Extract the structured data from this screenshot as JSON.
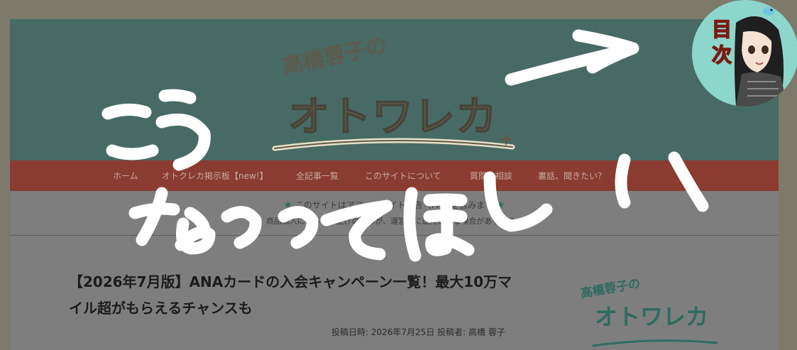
{
  "header": {
    "logo_subtitle": "高橋蓉子の",
    "logo_main": "オトワレカ"
  },
  "nav": {
    "items": [
      {
        "label": "ホーム"
      },
      {
        "label": "オトクレカ掲示板【new!】"
      },
      {
        "label": "全記事一覧"
      },
      {
        "label": "このサイトについて"
      },
      {
        "label": "質問・相談"
      },
      {
        "label": "裏話、聞きたい？"
      }
    ]
  },
  "notice": {
    "line1": "このサイトはアフィリエイト広告（PR）を含みます",
    "line2": "商品購入による売り上げの一部が、運営者に還元される場合があります。"
  },
  "article": {
    "title": "【2026年7月版】ANAカードの入会キャンペーン一覧！最大10万マイル超がもらえるチャンスも",
    "meta_date_label": "投稿日時:",
    "meta_date": "2026年7月25日",
    "meta_author_label": "投稿者:",
    "meta_author": "高橋 蓉子"
  },
  "sidebar": {
    "logo_subtitle": "高橋蓉子の",
    "logo_main": "オトワレカ"
  },
  "toc_button": {
    "label": "目次"
  },
  "annotation": {
    "text_left": "こう",
    "text_main": "なってほしい"
  },
  "colors": {
    "header_bg": "#476a65",
    "nav_bg": "#8a3c30",
    "accent_green": "#2f6b63",
    "toc_bg": "#8cd6cc"
  }
}
